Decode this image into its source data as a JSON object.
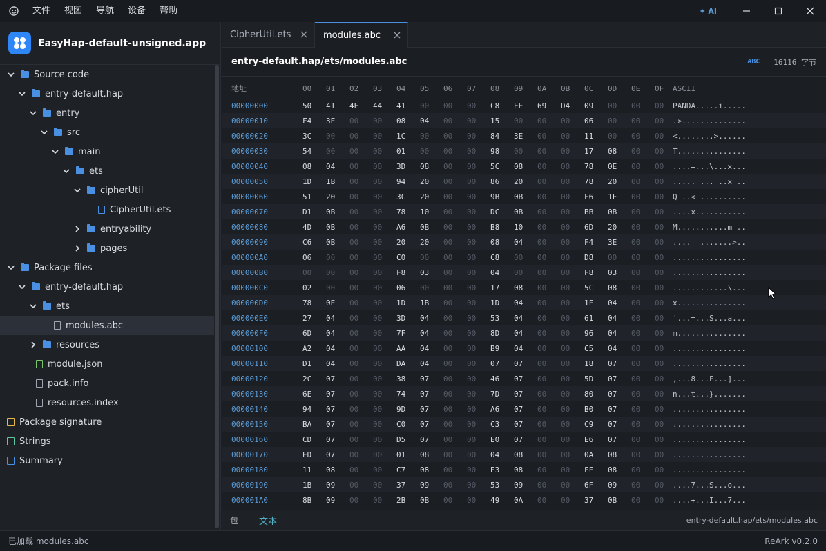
{
  "menu": [
    "文件",
    "视图",
    "导航",
    "设备",
    "帮助"
  ],
  "ai_label": "✦ AI",
  "project": {
    "name": "EasyHap-default-unsigned.app"
  },
  "tree": [
    {
      "label": "Source code",
      "depth": 0,
      "kind": "folder",
      "chev": "down"
    },
    {
      "label": "entry-default.hap",
      "depth": 1,
      "kind": "folder",
      "chev": "down"
    },
    {
      "label": "entry",
      "depth": 2,
      "kind": "folder",
      "chev": "down"
    },
    {
      "label": "src",
      "depth": 3,
      "kind": "folder",
      "chev": "down"
    },
    {
      "label": "main",
      "depth": 4,
      "kind": "folder",
      "chev": "down"
    },
    {
      "label": "ets",
      "depth": 5,
      "kind": "folder",
      "chev": "down"
    },
    {
      "label": "cipherUtil",
      "depth": 6,
      "kind": "folder",
      "chev": "down"
    },
    {
      "label": "CipherUtil.ets",
      "depth": 7,
      "kind": "file-blue",
      "chev": ""
    },
    {
      "label": "entryability",
      "depth": 6,
      "kind": "folder",
      "chev": "right"
    },
    {
      "label": "pages",
      "depth": 6,
      "kind": "folder",
      "chev": "right"
    },
    {
      "label": "Package files",
      "depth": 0,
      "kind": "folder",
      "chev": "down"
    },
    {
      "label": "entry-default.hap",
      "depth": 1,
      "kind": "folder",
      "chev": "down"
    },
    {
      "label": "ets",
      "depth": 2,
      "kind": "folder",
      "chev": "down"
    },
    {
      "label": "modules.abc",
      "depth": 3,
      "kind": "file",
      "chev": "",
      "selected": true
    },
    {
      "label": "resources",
      "depth": 2,
      "kind": "folder",
      "chev": "right"
    },
    {
      "label": "module.json",
      "depth": 2,
      "kind": "file-green",
      "chev": "",
      "flat": true
    },
    {
      "label": "pack.info",
      "depth": 2,
      "kind": "file",
      "chev": "",
      "flat": true
    },
    {
      "label": "resources.index",
      "depth": 2,
      "kind": "file",
      "chev": "",
      "flat": true
    },
    {
      "label": "Package signature",
      "depth": 0,
      "kind": "sig",
      "chev": "",
      "flat": true
    },
    {
      "label": "Strings",
      "depth": 0,
      "kind": "strings",
      "chev": "",
      "flat": true
    },
    {
      "label": "Summary",
      "depth": 0,
      "kind": "summary",
      "chev": "",
      "flat": true
    }
  ],
  "tabs": [
    {
      "label": "CipherUtil.ets",
      "active": false
    },
    {
      "label": "modules.abc",
      "active": true
    }
  ],
  "file_header": {
    "path": "entry-default.hap/ets/modules.abc",
    "badge": "ABC",
    "size": "16116 字节"
  },
  "hex_header": {
    "addr": "地址",
    "cols": [
      "00",
      "01",
      "02",
      "03",
      "04",
      "05",
      "06",
      "07",
      "08",
      "09",
      "0A",
      "0B",
      "0C",
      "0D",
      "0E",
      "0F"
    ],
    "ascii": "ASCII"
  },
  "hex_rows": [
    {
      "addr": "00000000",
      "bytes": [
        "50",
        "41",
        "4E",
        "44",
        "41",
        "00",
        "00",
        "00",
        "C8",
        "EE",
        "69",
        "D4",
        "09",
        "00",
        "00",
        "00"
      ],
      "ascii": "PANDA.....i....."
    },
    {
      "addr": "00000010",
      "bytes": [
        "F4",
        "3E",
        "00",
        "00",
        "08",
        "04",
        "00",
        "00",
        "15",
        "00",
        "00",
        "00",
        "06",
        "00",
        "00",
        "00"
      ],
      "ascii": ".>.............."
    },
    {
      "addr": "00000020",
      "bytes": [
        "3C",
        "00",
        "00",
        "00",
        "1C",
        "00",
        "00",
        "00",
        "84",
        "3E",
        "00",
        "00",
        "11",
        "00",
        "00",
        "00"
      ],
      "ascii": "<........>......"
    },
    {
      "addr": "00000030",
      "bytes": [
        "54",
        "00",
        "00",
        "00",
        "01",
        "00",
        "00",
        "00",
        "98",
        "00",
        "00",
        "00",
        "17",
        "08",
        "00",
        "00"
      ],
      "ascii": "T..............."
    },
    {
      "addr": "00000040",
      "bytes": [
        "08",
        "04",
        "00",
        "00",
        "3D",
        "08",
        "00",
        "00",
        "5C",
        "08",
        "00",
        "00",
        "78",
        "0E",
        "00",
        "00"
      ],
      "ascii": "....=...\\...x..."
    },
    {
      "addr": "00000050",
      "bytes": [
        "1D",
        "1B",
        "00",
        "00",
        "94",
        "20",
        "00",
        "00",
        "86",
        "20",
        "00",
        "00",
        "78",
        "20",
        "00",
        "00"
      ],
      "ascii": "..... ... ..x .."
    },
    {
      "addr": "00000060",
      "bytes": [
        "51",
        "20",
        "00",
        "00",
        "3C",
        "20",
        "00",
        "00",
        "9B",
        "0B",
        "00",
        "00",
        "F6",
        "1F",
        "00",
        "00"
      ],
      "ascii": "Q ..< .........."
    },
    {
      "addr": "00000070",
      "bytes": [
        "D1",
        "0B",
        "00",
        "00",
        "78",
        "10",
        "00",
        "00",
        "DC",
        "0B",
        "00",
        "00",
        "BB",
        "0B",
        "00",
        "00"
      ],
      "ascii": "....x..........."
    },
    {
      "addr": "00000080",
      "bytes": [
        "4D",
        "0B",
        "00",
        "00",
        "A6",
        "0B",
        "00",
        "00",
        "B8",
        "10",
        "00",
        "00",
        "6D",
        "20",
        "00",
        "00"
      ],
      "ascii": "M...........m .."
    },
    {
      "addr": "00000090",
      "bytes": [
        "C6",
        "0B",
        "00",
        "00",
        "20",
        "20",
        "00",
        "00",
        "08",
        "04",
        "00",
        "00",
        "F4",
        "3E",
        "00",
        "00"
      ],
      "ascii": "....  .......>.."
    },
    {
      "addr": "000000A0",
      "bytes": [
        "06",
        "00",
        "00",
        "00",
        "C0",
        "00",
        "00",
        "00",
        "C8",
        "00",
        "00",
        "00",
        "D8",
        "00",
        "00",
        "00"
      ],
      "ascii": "................"
    },
    {
      "addr": "000000B0",
      "bytes": [
        "00",
        "00",
        "00",
        "00",
        "F8",
        "03",
        "00",
        "00",
        "04",
        "00",
        "00",
        "00",
        "F8",
        "03",
        "00",
        "00"
      ],
      "ascii": "................"
    },
    {
      "addr": "000000C0",
      "bytes": [
        "02",
        "00",
        "00",
        "00",
        "06",
        "00",
        "00",
        "00",
        "17",
        "08",
        "00",
        "00",
        "5C",
        "08",
        "00",
        "00"
      ],
      "ascii": "............\\..."
    },
    {
      "addr": "000000D0",
      "bytes": [
        "78",
        "0E",
        "00",
        "00",
        "1D",
        "1B",
        "00",
        "00",
        "1D",
        "04",
        "00",
        "00",
        "1F",
        "04",
        "00",
        "00"
      ],
      "ascii": "x..............."
    },
    {
      "addr": "000000E0",
      "bytes": [
        "27",
        "04",
        "00",
        "00",
        "3D",
        "04",
        "00",
        "00",
        "53",
        "04",
        "00",
        "00",
        "61",
        "04",
        "00",
        "00"
      ],
      "ascii": "'...=...S...a..."
    },
    {
      "addr": "000000F0",
      "bytes": [
        "6D",
        "04",
        "00",
        "00",
        "7F",
        "04",
        "00",
        "00",
        "8D",
        "04",
        "00",
        "00",
        "96",
        "04",
        "00",
        "00"
      ],
      "ascii": "m..............."
    },
    {
      "addr": "00000100",
      "bytes": [
        "A2",
        "04",
        "00",
        "00",
        "AA",
        "04",
        "00",
        "00",
        "B9",
        "04",
        "00",
        "00",
        "C5",
        "04",
        "00",
        "00"
      ],
      "ascii": "................"
    },
    {
      "addr": "00000110",
      "bytes": [
        "D1",
        "04",
        "00",
        "00",
        "DA",
        "04",
        "00",
        "00",
        "07",
        "07",
        "00",
        "00",
        "18",
        "07",
        "00",
        "00"
      ],
      "ascii": "................"
    },
    {
      "addr": "00000120",
      "bytes": [
        "2C",
        "07",
        "00",
        "00",
        "38",
        "07",
        "00",
        "00",
        "46",
        "07",
        "00",
        "00",
        "5D",
        "07",
        "00",
        "00"
      ],
      "ascii": ",...8...F...]..."
    },
    {
      "addr": "00000130",
      "bytes": [
        "6E",
        "07",
        "00",
        "00",
        "74",
        "07",
        "00",
        "00",
        "7D",
        "07",
        "00",
        "00",
        "80",
        "07",
        "00",
        "00"
      ],
      "ascii": "n...t...}......."
    },
    {
      "addr": "00000140",
      "bytes": [
        "94",
        "07",
        "00",
        "00",
        "9D",
        "07",
        "00",
        "00",
        "A6",
        "07",
        "00",
        "00",
        "B0",
        "07",
        "00",
        "00"
      ],
      "ascii": "................"
    },
    {
      "addr": "00000150",
      "bytes": [
        "BA",
        "07",
        "00",
        "00",
        "C0",
        "07",
        "00",
        "00",
        "C3",
        "07",
        "00",
        "00",
        "C9",
        "07",
        "00",
        "00"
      ],
      "ascii": "................"
    },
    {
      "addr": "00000160",
      "bytes": [
        "CD",
        "07",
        "00",
        "00",
        "D5",
        "07",
        "00",
        "00",
        "E0",
        "07",
        "00",
        "00",
        "E6",
        "07",
        "00",
        "00"
      ],
      "ascii": "................"
    },
    {
      "addr": "00000170",
      "bytes": [
        "ED",
        "07",
        "00",
        "00",
        "01",
        "08",
        "00",
        "00",
        "04",
        "08",
        "00",
        "00",
        "0A",
        "08",
        "00",
        "00"
      ],
      "ascii": "................"
    },
    {
      "addr": "00000180",
      "bytes": [
        "11",
        "08",
        "00",
        "00",
        "C7",
        "08",
        "00",
        "00",
        "E3",
        "08",
        "00",
        "00",
        "FF",
        "08",
        "00",
        "00"
      ],
      "ascii": "................"
    },
    {
      "addr": "00000190",
      "bytes": [
        "1B",
        "09",
        "00",
        "00",
        "37",
        "09",
        "00",
        "00",
        "53",
        "09",
        "00",
        "00",
        "6F",
        "09",
        "00",
        "00"
      ],
      "ascii": "....7...S...o..."
    },
    {
      "addr": "000001A0",
      "bytes": [
        "8B",
        "09",
        "00",
        "00",
        "2B",
        "0B",
        "00",
        "00",
        "49",
        "0A",
        "00",
        "00",
        "37",
        "0B",
        "00",
        "00"
      ],
      "ascii": "....+...I...7..."
    }
  ],
  "bottom": {
    "tabs": [
      "包",
      "文本"
    ],
    "path": "entry-default.hap/ets/modules.abc"
  },
  "status": {
    "left": "已加载 modules.abc",
    "right": "ReArk v0.2.0"
  },
  "colors": {
    "accent": "#4a90e2",
    "folder": "#4a90e2",
    "address": "#5b9bd5",
    "zero_byte": "#555b66"
  }
}
